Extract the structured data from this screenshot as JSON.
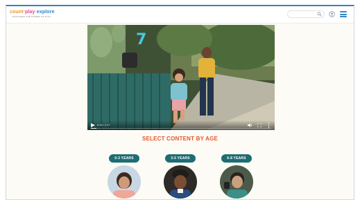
{
  "header": {
    "logo_word1": "count",
    "logo_word2": "play",
    "logo_word3": "explore",
    "logo_dot": "·",
    "tagline": "DISCOVER THE POWER OF PLAY",
    "search_placeholder": "",
    "icons": [
      "search-icon",
      "user-icon",
      "menu-icon"
    ]
  },
  "video": {
    "overlay_number": "7",
    "time": "0:00 / 2:17",
    "progress": 0.03,
    "icons": [
      "play-icon",
      "volume-icon",
      "fullscreen-icon",
      "more-icon"
    ]
  },
  "section_title": "SELECT CONTENT BY AGE",
  "ages": [
    {
      "label": "0-3 YEARS"
    },
    {
      "label": "3-5 YEARS"
    },
    {
      "label": "6-8 YEARS"
    }
  ],
  "colors": {
    "accent_orange": "#e3582b",
    "pill_teal": "#1d6d72",
    "brand_blue": "#2f86c6",
    "number_cyan": "#46c8e0"
  }
}
